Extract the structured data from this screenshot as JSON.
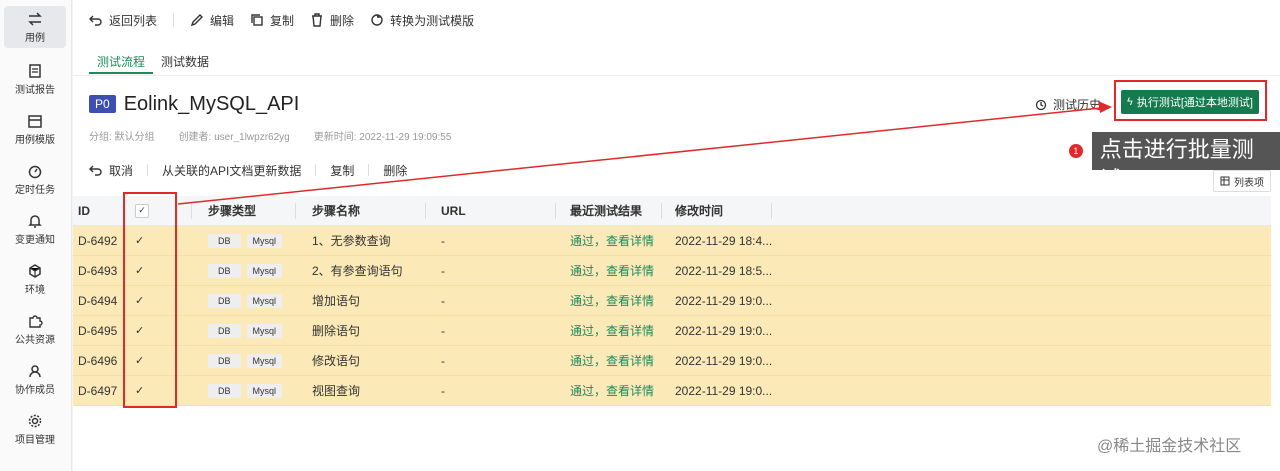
{
  "sidebar": {
    "items": [
      {
        "label": "用例",
        "icon": "swap-icon",
        "active": true
      },
      {
        "label": "测试报告",
        "icon": "report-icon"
      },
      {
        "label": "用例模版",
        "icon": "template-icon"
      },
      {
        "label": "定时任务",
        "icon": "timer-icon"
      },
      {
        "label": "变更通知",
        "icon": "bell-icon"
      },
      {
        "label": "环境",
        "icon": "cube-icon"
      },
      {
        "label": "公共资源",
        "icon": "puzzle-icon"
      },
      {
        "label": "协作成员",
        "icon": "user-icon"
      },
      {
        "label": "项目管理",
        "icon": "gear-icon"
      }
    ]
  },
  "toolbar": {
    "back": "返回列表",
    "edit": "编辑",
    "copy": "复制",
    "delete": "删除",
    "convert": "转换为测试模版"
  },
  "tabs": [
    "测试流程",
    "测试数据"
  ],
  "case": {
    "priority": "P0",
    "title": "Eolink_MySQL_API",
    "group": "分组: 默认分组",
    "creator": "创建者: user_1lwpzr62yg",
    "updated": "更新时间: 2022-11-29 19:09:55"
  },
  "history_label": "测试历史",
  "run_button": "执行测试[通过本地测试]",
  "callout": {
    "number": "1",
    "text": "点击进行批量测试"
  },
  "actions": {
    "cancel": "取消",
    "update_from_api": "从关联的API文档更新数据",
    "copy": "复制",
    "delete": "删除"
  },
  "column_settings": "列表项",
  "table": {
    "headers": {
      "id": "ID",
      "step_type": "步骤类型",
      "step_name": "步骤名称",
      "url": "URL",
      "result": "最近测试结果",
      "modified": "修改时间"
    },
    "rows": [
      {
        "id": "D-6492",
        "type_a": "DB",
        "type_b": "Mysql",
        "name": "1、无参数查询",
        "url": "-",
        "result": "通过，查看详情",
        "time": "2022-11-29 18:4..."
      },
      {
        "id": "D-6493",
        "type_a": "DB",
        "type_b": "Mysql",
        "name": "2、有参查询语句",
        "url": "-",
        "result": "通过，查看详情",
        "time": "2022-11-29 18:5..."
      },
      {
        "id": "D-6494",
        "type_a": "DB",
        "type_b": "Mysql",
        "name": "增加语句",
        "url": "-",
        "result": "通过，查看详情",
        "time": "2022-11-29 19:0..."
      },
      {
        "id": "D-6495",
        "type_a": "DB",
        "type_b": "Mysql",
        "name": "删除语句",
        "url": "-",
        "result": "通过，查看详情",
        "time": "2022-11-29 19:0..."
      },
      {
        "id": "D-6496",
        "type_a": "DB",
        "type_b": "Mysql",
        "name": "修改语句",
        "url": "-",
        "result": "通过，查看详情",
        "time": "2022-11-29 19:0..."
      },
      {
        "id": "D-6497",
        "type_a": "DB",
        "type_b": "Mysql",
        "name": "视图查询",
        "url": "-",
        "result": "通过，查看详情",
        "time": "2022-11-29 19:0..."
      }
    ]
  },
  "watermark": "@稀土掘金技术社区",
  "colors": {
    "accent": "#167a4f",
    "highlight_row": "#fbe9b7",
    "annotation": "#e02a2a",
    "priority": "#3e4fb4"
  }
}
